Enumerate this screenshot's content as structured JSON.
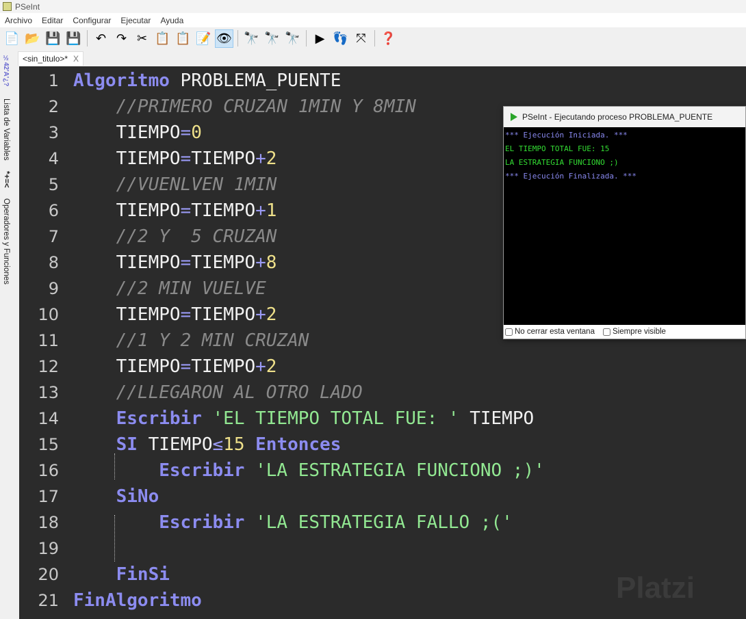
{
  "app": {
    "title": "PSeInt"
  },
  "menu": [
    "Archivo",
    "Editar",
    "Configurar",
    "Ejecutar",
    "Ayuda"
  ],
  "toolbar": [
    {
      "name": "new-file-icon",
      "glyph": "📄"
    },
    {
      "name": "open-icon",
      "glyph": "📂"
    },
    {
      "name": "save-icon",
      "glyph": "💾"
    },
    {
      "name": "save-as-icon",
      "glyph": "💾"
    },
    {
      "sep": true
    },
    {
      "name": "undo-icon",
      "glyph": "↶"
    },
    {
      "name": "redo-icon",
      "glyph": "↷"
    },
    {
      "name": "cut-icon",
      "glyph": "✂"
    },
    {
      "name": "copy-icon",
      "glyph": "📋"
    },
    {
      "name": "paste-icon",
      "glyph": "📋"
    },
    {
      "name": "indent-icon",
      "glyph": "📝"
    },
    {
      "name": "debug-watch-icon",
      "glyph": "👁",
      "active": true
    },
    {
      "sep": true
    },
    {
      "name": "find-icon",
      "glyph": "🔭"
    },
    {
      "name": "find-prev-icon",
      "glyph": "🔭"
    },
    {
      "name": "find-next-icon",
      "glyph": "🔭"
    },
    {
      "sep": true
    },
    {
      "name": "run-icon",
      "glyph": "▶"
    },
    {
      "name": "step-icon",
      "glyph": "👣"
    },
    {
      "name": "flowchart-icon",
      "glyph": "⤧"
    },
    {
      "sep": true
    },
    {
      "name": "help-icon",
      "glyph": "❓"
    }
  ],
  "tab": {
    "label": "<sin_titulo>*",
    "close": "X"
  },
  "sidebar": {
    "symbols": "½42'A'¿?",
    "variables": "Lista de Variables",
    "op_symbols": "*+=<",
    "operators": "Operadores y Funciones"
  },
  "code": [
    [
      [
        "kw",
        "Algoritmo"
      ],
      [
        "id",
        " PROBLEMA_PUENTE"
      ]
    ],
    [
      [
        "id",
        "    "
      ],
      [
        "cm",
        "//PRIMERO CRUZAN 1MIN Y 8MIN"
      ]
    ],
    [
      [
        "id",
        "    TIEMPO"
      ],
      [
        "op",
        "="
      ],
      [
        "num",
        "0"
      ]
    ],
    [
      [
        "id",
        "    TIEMPO"
      ],
      [
        "op",
        "="
      ],
      [
        "id",
        "TIEMPO"
      ],
      [
        "op",
        "+"
      ],
      [
        "num",
        "2"
      ]
    ],
    [
      [
        "id",
        "    "
      ],
      [
        "cm",
        "//VUENLVEN 1MIN"
      ]
    ],
    [
      [
        "id",
        "    TIEMPO"
      ],
      [
        "op",
        "="
      ],
      [
        "id",
        "TIEMPO"
      ],
      [
        "op",
        "+"
      ],
      [
        "num",
        "1"
      ]
    ],
    [
      [
        "id",
        "    "
      ],
      [
        "cm",
        "//2 Y  5 CRUZAN"
      ]
    ],
    [
      [
        "id",
        "    TIEMPO"
      ],
      [
        "op",
        "="
      ],
      [
        "id",
        "TIEMPO"
      ],
      [
        "op",
        "+"
      ],
      [
        "num",
        "8"
      ]
    ],
    [
      [
        "id",
        "    "
      ],
      [
        "cm",
        "//2 MIN VUELVE"
      ]
    ],
    [
      [
        "id",
        "    TIEMPO"
      ],
      [
        "op",
        "="
      ],
      [
        "id",
        "TIEMPO"
      ],
      [
        "op",
        "+"
      ],
      [
        "num",
        "2"
      ]
    ],
    [
      [
        "id",
        "    "
      ],
      [
        "cm",
        "//1 Y 2 MIN CRUZAN"
      ]
    ],
    [
      [
        "id",
        "    TIEMPO"
      ],
      [
        "op",
        "="
      ],
      [
        "id",
        "TIEMPO"
      ],
      [
        "op",
        "+"
      ],
      [
        "num",
        "2"
      ]
    ],
    [
      [
        "id",
        "    "
      ],
      [
        "cm",
        "//LLEGARON AL OTRO LADO"
      ]
    ],
    [
      [
        "id",
        "    "
      ],
      [
        "kw",
        "Escribir"
      ],
      [
        "id",
        " "
      ],
      [
        "str",
        "'EL TIEMPO TOTAL FUE: '"
      ],
      [
        "id",
        " TIEMPO"
      ]
    ],
    [
      [
        "id",
        "    "
      ],
      [
        "kw",
        "SI"
      ],
      [
        "id",
        " TIEMPO"
      ],
      [
        "op",
        "≤"
      ],
      [
        "num",
        "15"
      ],
      [
        "id",
        " "
      ],
      [
        "kw",
        "Entonces"
      ]
    ],
    [
      [
        "id",
        "        "
      ],
      [
        "kw",
        "Escribir"
      ],
      [
        "id",
        " "
      ],
      [
        "str",
        "'LA ESTRATEGIA FUNCIONO ;)'"
      ]
    ],
    [
      [
        "id",
        "    "
      ],
      [
        "kw",
        "SiNo"
      ]
    ],
    [
      [
        "id",
        "        "
      ],
      [
        "kw",
        "Escribir"
      ],
      [
        "id",
        " "
      ],
      [
        "str",
        "'LA ESTRATEGIA FALLO ;('"
      ]
    ],
    [],
    [
      [
        "id",
        "    "
      ],
      [
        "kw",
        "FinSi"
      ]
    ],
    [
      [
        "kw",
        "FinAlgoritmo"
      ]
    ]
  ],
  "run_window": {
    "title": "PSeInt - Ejecutando proceso PROBLEMA_PUENTE",
    "output": [
      [
        "info",
        "*** Ejecución Iniciada. ***"
      ],
      [
        "out",
        "EL TIEMPO TOTAL FUE: 15"
      ],
      [
        "out",
        "LA ESTRATEGIA FUNCIONO ;)"
      ],
      [
        "info",
        "*** Ejecución Finalizada. ***"
      ]
    ],
    "no_close_label": "No cerrar esta ventana",
    "always_visible_label": "Siempre visible"
  },
  "watermark": "Platzi"
}
